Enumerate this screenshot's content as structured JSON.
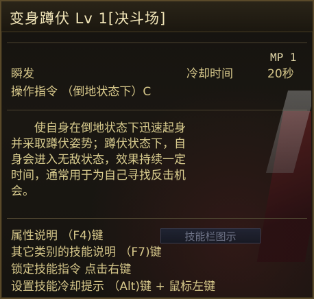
{
  "skill": {
    "title": "变身蹲伏 Lv 1[决斗场]",
    "mp": "MP 1",
    "cast_type": "瞬发",
    "cooldown_label": "冷却时间",
    "cooldown_value": "20秒",
    "command": "操作指令  （倒地状态下）C"
  },
  "description": [
    "　　使自身在倒地状态下迅速起身",
    "并采取蹲伏姿势；蹲伏状态下，自",
    "身会进入无敌状态，效果持续一定",
    "时间，通常用于为自己寻找反击机",
    "会。"
  ],
  "footer": {
    "attr_info": "属性说明  （F4)键",
    "other_skills": "其它类别的技能说明 （F7)键",
    "lock_skill": "锁定技能指令  点击右键",
    "cooldown_hint": "设置技能冷却提示 （Alt)键 + 鼠标左键",
    "overlay_button": "技能栏图示"
  },
  "colors": {
    "title": "#f2e6b8",
    "body_text": "#d6c78a",
    "border": "#5a4a2a",
    "background": "#15130f"
  }
}
